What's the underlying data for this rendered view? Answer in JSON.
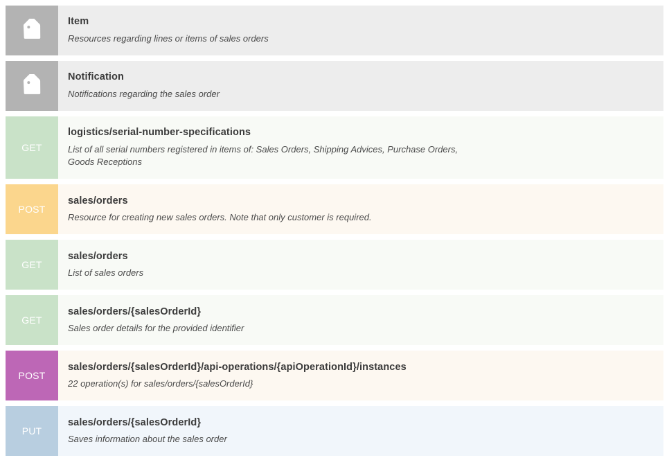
{
  "list": {
    "rows": [
      {
        "kind": "tag",
        "icon": "tag-icon",
        "method": "",
        "title": "Item",
        "description": "Resources regarding lines or items of sales orders"
      },
      {
        "kind": "tag",
        "icon": "tag-icon",
        "method": "",
        "title": "Notification",
        "description": "Notifications regarding the sales order"
      },
      {
        "kind": "get",
        "icon": "",
        "method": "GET",
        "title": "logistics/serial-number-specifications",
        "description": "List of all serial numbers registered in items of: Sales Orders, Shipping Advices, Purchase Orders, Goods Receptions"
      },
      {
        "kind": "post",
        "icon": "",
        "method": "POST",
        "title": "sales/orders",
        "description": "Resource for creating new sales orders. Note that only customer is required."
      },
      {
        "kind": "get",
        "icon": "",
        "method": "GET",
        "title": "sales/orders",
        "description": "List of sales orders"
      },
      {
        "kind": "get",
        "icon": "",
        "method": "GET",
        "title": "sales/orders/{salesOrderId}",
        "description": "Sales order details for the provided identifier"
      },
      {
        "kind": "post-op",
        "icon": "",
        "method": "POST",
        "title": "sales/orders/{salesOrderId}/api-operations/{apiOperationId}/instances",
        "description": "22 operation(s) for sales/orders/{salesOrderId}"
      },
      {
        "kind": "put",
        "icon": "",
        "method": "PUT",
        "title": "sales/orders/{salesOrderId}",
        "description": "Saves information about the sales order"
      }
    ]
  },
  "colors": {
    "tag_badge": "#b3b3b3",
    "tag_body": "#ededed",
    "get_badge": "#c9e2c8",
    "get_body": "#f8faf6",
    "post_badge": "#fbd68d",
    "post_body": "#fdf8f1",
    "post_operation_badge": "#bd67b6",
    "put_badge": "#b8cee0",
    "put_body": "#f1f6fb",
    "title_text": "#3b3b3b",
    "description_text": "#4a4a4a",
    "badge_label_text": "#ffffff"
  }
}
